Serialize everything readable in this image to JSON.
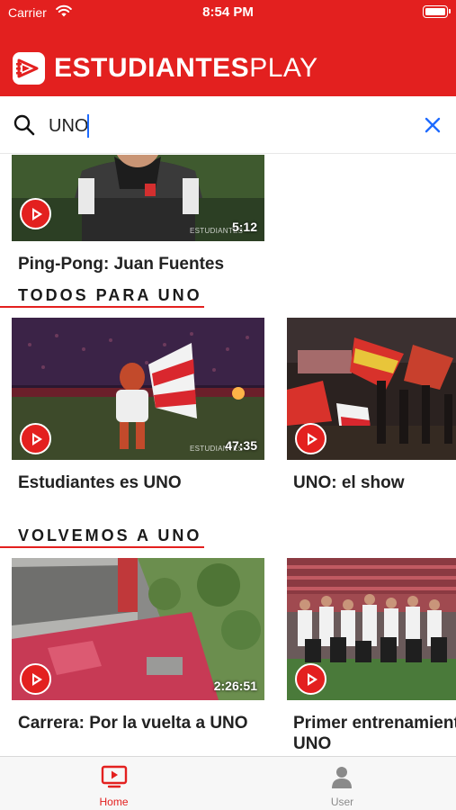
{
  "status_bar": {
    "carrier": "Carrier",
    "time": "8:54 PM"
  },
  "header": {
    "brand_bold": "ESTUDIANTES",
    "brand_light": "PLAY"
  },
  "search": {
    "query": "UNO"
  },
  "top_item": {
    "title": "Ping-Pong: Juan Fuentes",
    "duration": "5:12",
    "watermark": "ESTUDIANTES"
  },
  "sections": [
    {
      "title": "TODOS PARA UNO",
      "items": [
        {
          "title": "Estudiantes es UNO",
          "duration": "47:35",
          "watermark": "ESTUDIANTES"
        },
        {
          "title": "UNO: el show",
          "duration": ""
        }
      ]
    },
    {
      "title": "VOLVEMOS A UNO",
      "items": [
        {
          "title": "Carrera: Por la vuelta a UNO",
          "duration": "2:26:51"
        },
        {
          "title_line1": "Primer entrenamiento",
          "title_line2": "UNO",
          "duration": ""
        }
      ]
    }
  ],
  "tab_bar": {
    "home": "Home",
    "user": "User"
  },
  "colors": {
    "brand_red": "#e3201f",
    "search_accent": "#1e6bff"
  }
}
